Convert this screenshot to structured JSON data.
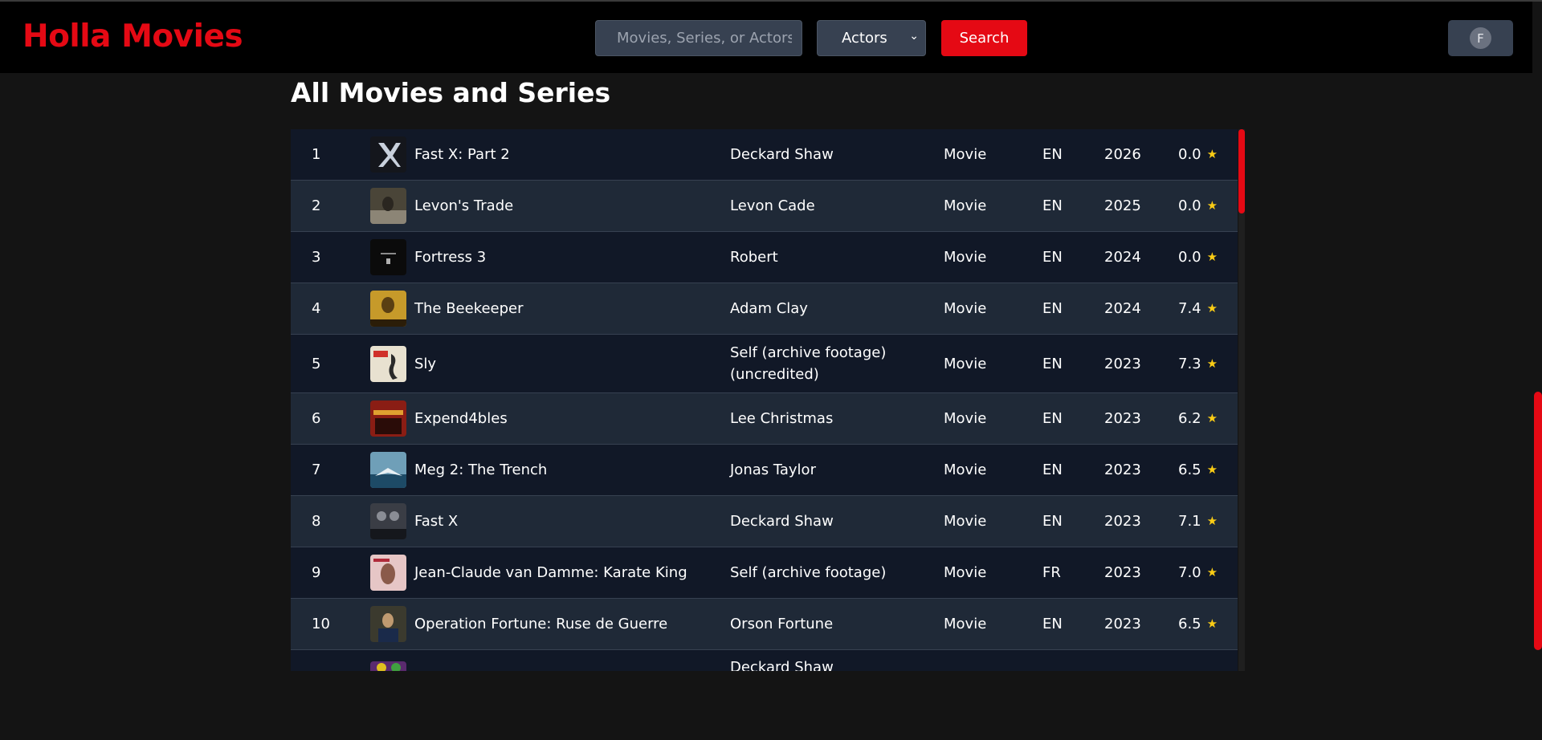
{
  "header": {
    "logo": "Holla Movies",
    "search_placeholder": "Movies, Series, or Actors..",
    "filter_selected": "Actors",
    "search_label": "Search",
    "avatar_initial": "F"
  },
  "page_title": "All Movies and Series",
  "rows": [
    {
      "num": "1",
      "title": "Fast X: Part 2",
      "role": "Deckard Shaw",
      "type": "Movie",
      "lang": "EN",
      "year": "2026",
      "rating": "0.0",
      "poster": "#14161c"
    },
    {
      "num": "2",
      "title": "Levon's Trade",
      "role": "Levon Cade",
      "type": "Movie",
      "lang": "EN",
      "year": "2025",
      "rating": "0.0",
      "poster": "#4a4538"
    },
    {
      "num": "3",
      "title": "Fortress 3",
      "role": "Robert",
      "type": "Movie",
      "lang": "EN",
      "year": "2024",
      "rating": "0.0",
      "poster": "#0b0b0b"
    },
    {
      "num": "4",
      "title": "The Beekeeper",
      "role": "Adam Clay",
      "type": "Movie",
      "lang": "EN",
      "year": "2024",
      "rating": "7.4",
      "poster": "#c69a2a"
    },
    {
      "num": "5",
      "title": "Sly",
      "role_line1": "Self (archive footage)",
      "role_line2": "(uncredited)",
      "type": "Movie",
      "lang": "EN",
      "year": "2023",
      "rating": "7.3",
      "poster": "#e8e1d0"
    },
    {
      "num": "6",
      "title": "Expend4bles",
      "role": "Lee Christmas",
      "type": "Movie",
      "lang": "EN",
      "year": "2023",
      "rating": "6.2",
      "poster": "#8a1d14"
    },
    {
      "num": "7",
      "title": "Meg 2: The Trench",
      "role": "Jonas Taylor",
      "type": "Movie",
      "lang": "EN",
      "year": "2023",
      "rating": "6.5",
      "poster": "#6f9fb8"
    },
    {
      "num": "8",
      "title": "Fast X",
      "role": "Deckard Shaw",
      "type": "Movie",
      "lang": "EN",
      "year": "2023",
      "rating": "7.1",
      "poster": "#3a3d45"
    },
    {
      "num": "9",
      "title": "Jean-Claude van Damme: Karate King",
      "role": "Self (archive footage)",
      "type": "Movie",
      "lang": "FR",
      "year": "2023",
      "rating": "7.0",
      "poster": "#e6c6c6"
    },
    {
      "num": "10",
      "title": "Operation Fortune: Ruse de Guerre",
      "role": "Orson Fortune",
      "type": "Movie",
      "lang": "EN",
      "year": "2023",
      "rating": "6.5",
      "poster": "#3b3a2e"
    },
    {
      "role": "Deckard Shaw",
      "poster": "#5a2a6e"
    }
  ]
}
